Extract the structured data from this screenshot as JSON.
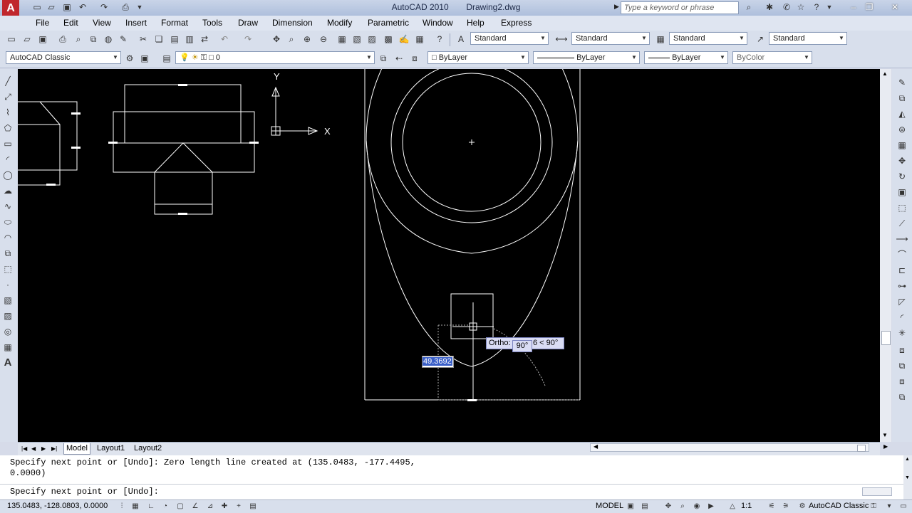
{
  "app": {
    "name": "AutoCAD 2010",
    "document": "Drawing2.dwg",
    "logo_letter": "A"
  },
  "search": {
    "placeholder": "Type a keyword or phrase"
  },
  "menu": [
    "File",
    "Edit",
    "View",
    "Insert",
    "Format",
    "Tools",
    "Draw",
    "Dimension",
    "Modify",
    "Parametric",
    "Window",
    "Help",
    "Express"
  ],
  "styles": {
    "text_style": "Standard",
    "dim_style": "Standard",
    "table_style": "Standard",
    "multileader_style": "Standard"
  },
  "workspace": "AutoCAD Classic",
  "layer": {
    "current": "0"
  },
  "properties": {
    "color": "ByLayer",
    "linetype": "ByLayer",
    "lineweight": "ByLayer",
    "plotstyle": "ByColor"
  },
  "ucs": {
    "x_label": "X",
    "y_label": "Y"
  },
  "tooltip": {
    "ortho_prefix": "Ortho:",
    "ortho_suffix": "6 < 90°",
    "angle": "90°",
    "length_input": "49.3692"
  },
  "tabs": {
    "model": "Model",
    "layout1": "Layout1",
    "layout2": "Layout2"
  },
  "command": {
    "line1": "Specify next point or [Undo]: Zero length line created at (135.0483, -177.4495,",
    "line2": "0.0000)",
    "prompt": "Specify next point or [Undo]:"
  },
  "status": {
    "coords": "135.0483, -128.0803, 0.0000",
    "model": "MODEL",
    "scale": "1:1",
    "workspace": "AutoCAD Classic"
  }
}
